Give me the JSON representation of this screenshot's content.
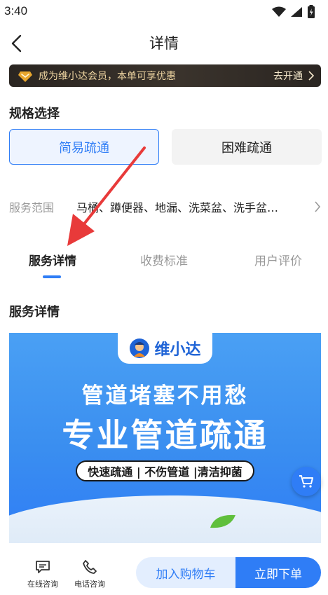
{
  "status_bar": {
    "time": "3:40",
    "icons": [
      "wifi-icon",
      "signal-icon",
      "battery-icon"
    ]
  },
  "header": {
    "title": "详情",
    "back_icon": "chevron-left-icon"
  },
  "member_banner": {
    "text": "成为维小达会员，本单可享优惠",
    "cta": "去开通",
    "icon": "diamond-icon"
  },
  "spec": {
    "title": "规格选择",
    "options": [
      {
        "label": "简易疏通",
        "selected": true
      },
      {
        "label": "困难疏通",
        "selected": false
      }
    ]
  },
  "service_range": {
    "label": "服务范围",
    "value": "马桶、蹲便器、地漏、洗菜盆、洗手盆…"
  },
  "tabs": [
    {
      "label": "服务详情",
      "active": true
    },
    {
      "label": "收费标准",
      "active": false
    },
    {
      "label": "用户评价",
      "active": false
    }
  ],
  "detail": {
    "title": "服务详情",
    "banner": {
      "brand": "维小达",
      "headline": "管道堵塞不用愁",
      "main": "专业管道疏通",
      "features": "快速疏通 | 不伤管道 |清洁抑菌"
    }
  },
  "bottom_bar": {
    "online_consult": "在线咨询",
    "phone_consult": "电话咨询",
    "add_to_cart": "加入购物车",
    "order_now": "立即下单"
  },
  "colors": {
    "accent": "#2f7df6",
    "annotation": "#e83a3a",
    "gold": "#ecd3a0"
  }
}
